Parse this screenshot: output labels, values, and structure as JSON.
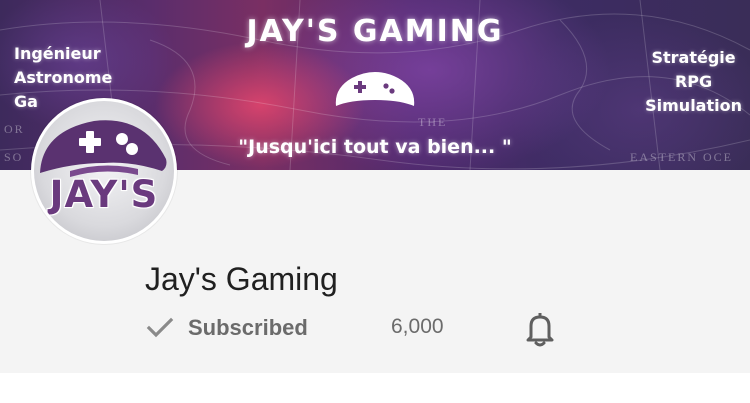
{
  "banner": {
    "title": "JAY'S GAMING",
    "quote": "\"Jusqu'ici tout va bien... \"",
    "left_lines": [
      "Ingénieur",
      "Astronome",
      "Ga"
    ],
    "right_lines": [
      "Stratégie",
      "RPG",
      "Simulation"
    ],
    "map_words": [
      "OR",
      "SO",
      "THE",
      "EASTERN OCE"
    ]
  },
  "channel": {
    "name": "Jay's Gaming",
    "subscribe_label": "Subscribed",
    "subscriber_count": "6,000",
    "avatar_text": "JAY'S"
  },
  "icons": {
    "subscribed": "check-icon",
    "notifications": "bell-icon"
  },
  "colors": {
    "channel_background": "#f4f4f4",
    "banner_accent": "#7a2f63",
    "avatar_brand": "#6a3a7e",
    "subscribed_text": "#6b6b6b"
  }
}
